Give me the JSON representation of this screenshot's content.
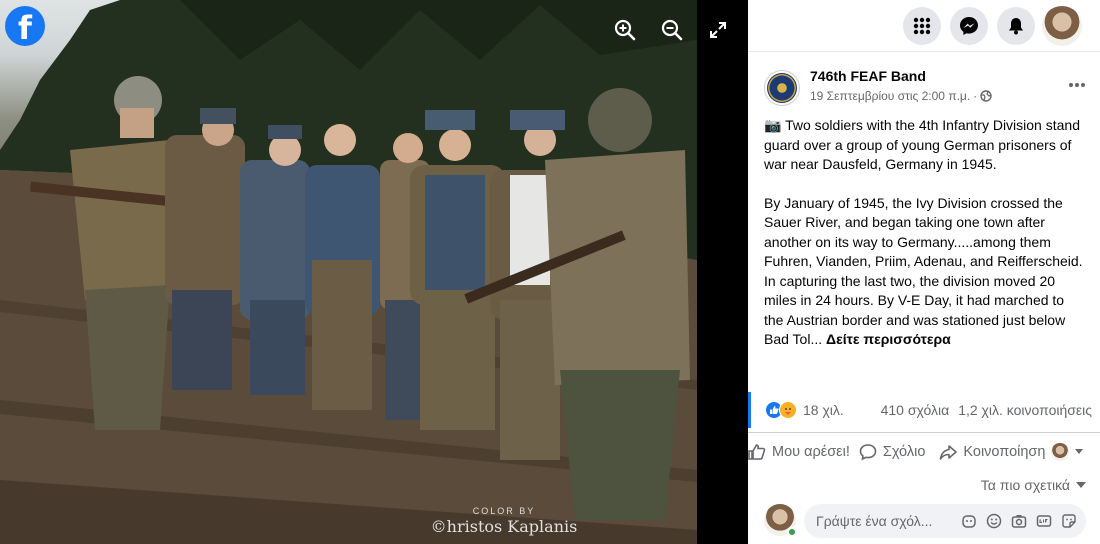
{
  "viewer": {
    "photo_credit_small": "COLOR BY",
    "photo_credit_big": "©hristos Kaplanis"
  },
  "post": {
    "page_name": "746th FEAF Band",
    "date": "19 Σεπτεμβρίου στις 2:00 π.μ.",
    "separator": "·",
    "paragraph_1": "📷 Two soldiers with the 4th Infantry Division stand guard over a group of young German prisoners of war near Dausfeld, Germany in 1945.",
    "paragraph_2": "By January of 1945, the Ivy Division crossed the Sauer River, and began taking one town after another on its way to Germany.....among them Fuhren, Vianden, Priim, Adenau, and Reifferscheid. In capturing the last two, the division moved 20 miles in 24 hours. By V-E Day, it had marched to the Austrian border and was stationed just below Bad Tol...",
    "see_more": "Δείτε περισσότερα"
  },
  "stats": {
    "reactions": "18 χιλ.",
    "comments": "410 σχόλια",
    "shares": "1,2 χιλ. κοινοποιήσεις"
  },
  "actions": {
    "like": "Μου αρέσει!",
    "comment": "Σχόλιο",
    "share": "Κοινοποίηση"
  },
  "comments": {
    "sort_label": "Τα πιο σχετικά",
    "placeholder": "Γράψτε ένα σχόλ..."
  },
  "colors": {
    "brand": "#1877f2",
    "online": "#31a24c"
  }
}
